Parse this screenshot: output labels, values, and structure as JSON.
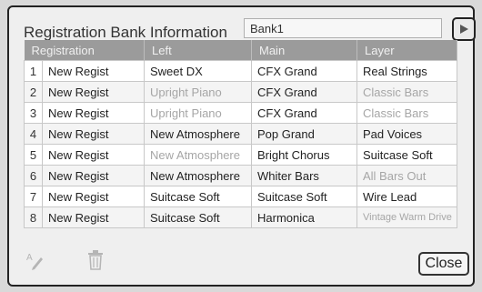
{
  "dialog": {
    "title": "Registration Bank Information",
    "bank_name": "Bank1",
    "next_icon": "play-right-icon"
  },
  "table": {
    "headers": [
      "Registration",
      "Left",
      "Main",
      "Layer"
    ],
    "rows": [
      {
        "num": "1",
        "registration": "New Regist",
        "left": "Sweet DX",
        "main": "CFX Grand",
        "layer": "Real Strings"
      },
      {
        "num": "2",
        "registration": "New Regist",
        "left": "Upright Piano",
        "main": "CFX Grand",
        "layer": "Classic Bars"
      },
      {
        "num": "3",
        "registration": "New Regist",
        "left": "Upright Piano",
        "main": "CFX Grand",
        "layer": "Classic Bars"
      },
      {
        "num": "4",
        "registration": "New Regist",
        "left": "New Atmosphere",
        "main": "Pop Grand",
        "layer": "Pad Voices"
      },
      {
        "num": "5",
        "registration": "New Regist",
        "left": "New Atmosphere",
        "main": "Bright Chorus",
        "layer": "Suitcase Soft"
      },
      {
        "num": "6",
        "registration": "New Regist",
        "left": "New Atmosphere",
        "main": "Whiter Bars",
        "layer": "All Bars Out"
      },
      {
        "num": "7",
        "registration": "New Regist",
        "left": "Suitcase Soft",
        "main": "Suitcase Soft",
        "layer": "Wire Lead"
      },
      {
        "num": "8",
        "registration": "New Regist",
        "left": "Suitcase Soft",
        "main": "Harmonica",
        "layer": "Vintage Warm Drive"
      }
    ]
  },
  "footer": {
    "close_label": "Close",
    "edit_icon": "rename-pencil-icon",
    "delete_icon": "trash-icon"
  },
  "colors": {
    "header_bg": "#9b9b9b",
    "disabled_text": "#a6a6a6",
    "panel_bg": "#efefef"
  }
}
